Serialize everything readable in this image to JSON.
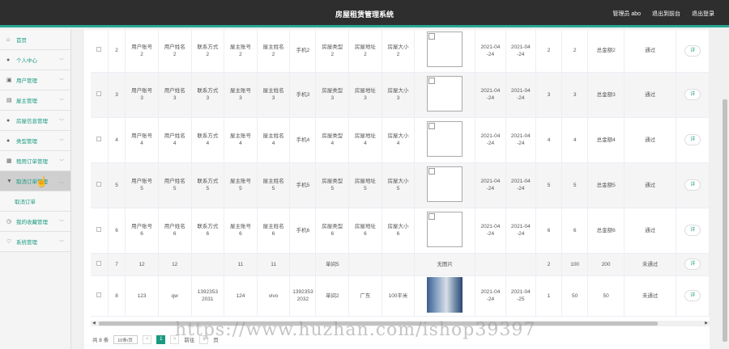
{
  "header": {
    "title": "房屋租赁管理系统",
    "admin_label": "管理员 abo",
    "back_label": "退出到前台",
    "logout_label": "退出登录"
  },
  "sidebar": {
    "items": [
      {
        "label": "首页",
        "icon": "home-icon"
      },
      {
        "label": "个人中心",
        "icon": "user-icon"
      },
      {
        "label": "用户管理",
        "icon": "users-icon"
      },
      {
        "label": "屋主管理",
        "icon": "owner-icon"
      },
      {
        "label": "房屋信息管理",
        "icon": "house-icon"
      },
      {
        "label": "类型管理",
        "icon": "type-icon"
      },
      {
        "label": "租用订单管理",
        "icon": "order-icon"
      },
      {
        "label": "取消订单管理",
        "icon": "cancel-icon"
      },
      {
        "label": "我的收藏管理",
        "icon": "favorite-icon"
      },
      {
        "label": "系统管理",
        "icon": "settings-icon"
      }
    ],
    "submenu_label": "取消订单"
  },
  "table": {
    "rows": [
      {
        "idx": "2",
        "c1": "用户账号\n2",
        "c2": "用户姓名\n2",
        "c3": "联系方式\n2",
        "c4": "屋主账号\n2",
        "c5": "屋主姓名\n2",
        "c6": "手机2",
        "c7": "房屋类型\n2",
        "c8": "房屋地址\n2",
        "c9": "房屋大小\n2",
        "img": "broken",
        "d1": "2021-04\n-24",
        "d2": "2021-04\n-24",
        "n1": "2",
        "n2": "2",
        "total": "总金额2",
        "status": "通过"
      },
      {
        "idx": "3",
        "c1": "用户账号\n3",
        "c2": "用户姓名\n3",
        "c3": "联系方式\n3",
        "c4": "屋主账号\n3",
        "c5": "屋主姓名\n3",
        "c6": "手机3",
        "c7": "房屋类型\n3",
        "c8": "房屋地址\n3",
        "c9": "房屋大小\n3",
        "img": "broken",
        "d1": "2021-04\n-24",
        "d2": "2021-04\n-24",
        "n1": "3",
        "n2": "3",
        "total": "总金额3",
        "status": "通过"
      },
      {
        "idx": "4",
        "c1": "用户账号\n4",
        "c2": "用户姓名\n4",
        "c3": "联系方式\n4",
        "c4": "屋主账号\n4",
        "c5": "屋主姓名\n4",
        "c6": "手机4",
        "c7": "房屋类型\n4",
        "c8": "房屋地址\n4",
        "c9": "房屋大小\n4",
        "img": "broken",
        "d1": "2021-04\n-24",
        "d2": "2021-04\n-24",
        "n1": "4",
        "n2": "4",
        "total": "总金额4",
        "status": "通过"
      },
      {
        "idx": "5",
        "c1": "用户账号\n5",
        "c2": "用户姓名\n5",
        "c3": "联系方式\n5",
        "c4": "屋主账号\n5",
        "c5": "屋主姓名\n5",
        "c6": "手机5",
        "c7": "房屋类型\n5",
        "c8": "房屋地址\n5",
        "c9": "房屋大小\n5",
        "img": "broken",
        "d1": "2021-04\n-24",
        "d2": "2021-04\n-24",
        "n1": "5",
        "n2": "5",
        "total": "总金额5",
        "status": "通过"
      },
      {
        "idx": "6",
        "c1": "用户账号\n6",
        "c2": "用户姓名\n6",
        "c3": "联系方式\n6",
        "c4": "屋主账号\n6",
        "c5": "屋主姓名\n6",
        "c6": "手机6",
        "c7": "房屋类型\n6",
        "c8": "房屋地址\n6",
        "c9": "房屋大小\n6",
        "img": "broken",
        "d1": "2021-04\n-24",
        "d2": "2021-04\n-24",
        "n1": "6",
        "n2": "6",
        "total": "总金额6",
        "status": "通过"
      },
      {
        "idx": "7",
        "c1": "12",
        "c2": "12",
        "c3": "",
        "c4": "11",
        "c5": "11",
        "c6": "",
        "c7": "单间5",
        "c8": "",
        "c9": "",
        "img": "none",
        "img_text": "无图片",
        "d1": "",
        "d2": "",
        "n1": "2",
        "n2": "100",
        "total": "200",
        "status": "未通过"
      },
      {
        "idx": "8",
        "c1": "123",
        "c2": "qw",
        "c3": "1392353\n2031",
        "c4": "124",
        "c5": "vivo",
        "c6": "1392353\n2032",
        "c7": "单间2",
        "c8": "广东",
        "c9": "100平米",
        "img": "photo",
        "d1": "2021-04\n-24",
        "d2": "2021-04\n-25",
        "n1": "1",
        "n2": "50",
        "total": "50",
        "status": "未通过"
      }
    ],
    "op_label": "详"
  },
  "pager": {
    "total_label": "共 8 条",
    "page_size": "10条/页",
    "prev": "<",
    "current": "1",
    "next": ">",
    "goto_label": "前往",
    "goto_value": "1",
    "page_suffix": "页"
  },
  "watermark": "https://www.huzhan.com/ishop39397"
}
